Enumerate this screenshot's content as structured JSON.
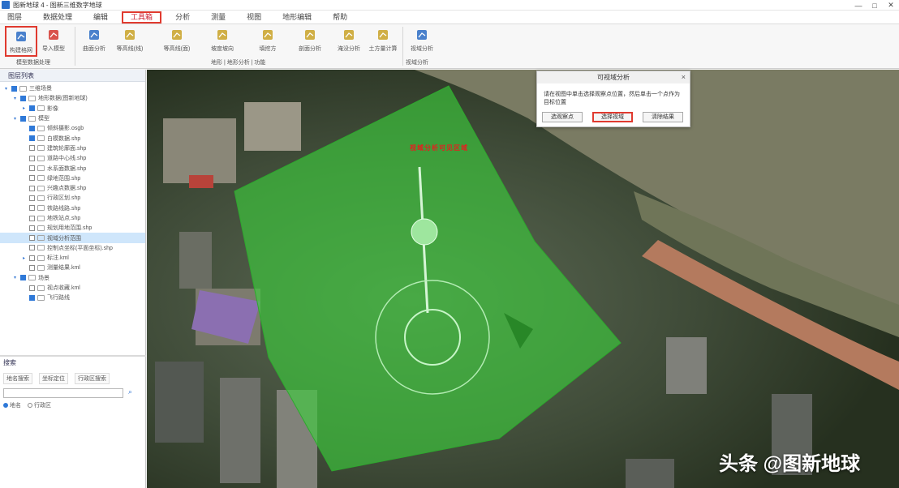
{
  "titlebar": {
    "title": "图新地球 4 - 图新三维数字地球",
    "minimize": "—",
    "maximize": "□",
    "close": "✕"
  },
  "menu": {
    "items": [
      "图层",
      "数据处理",
      "编辑",
      "工具箱",
      "分析",
      "测量",
      "视图",
      "地形编辑",
      "帮助"
    ],
    "active_index": 3
  },
  "ribbon": {
    "buttons": [
      {
        "label": "构建格网",
        "icon": "grid-icon"
      },
      {
        "label": "导入模型",
        "icon": "import-icon"
      },
      {
        "label": "曲面分析",
        "icon": "curve-icon"
      },
      {
        "label": "等高线(线)",
        "icon": "contour-icon"
      },
      {
        "label": "等高线(面)",
        "icon": "contour-area-icon"
      },
      {
        "label": "坡度坡向",
        "icon": "slope-icon"
      },
      {
        "label": "填挖方",
        "icon": "cutfill-icon"
      },
      {
        "label": "剖面分析",
        "icon": "profile-icon"
      },
      {
        "label": "淹没分析",
        "icon": "flood-icon"
      },
      {
        "label": "土方量计算",
        "icon": "volume-icon"
      },
      {
        "label": "视域分析",
        "icon": "viewshed-icon"
      }
    ],
    "groups": [
      "模型数据处理",
      "地形 | 地形分析 | 功能",
      "视域分析"
    ]
  },
  "panel": {
    "header": "图层列表",
    "tree": [
      {
        "label": "三维场景",
        "level": 0,
        "checked": true,
        "arrow": "▾"
      },
      {
        "label": "地形数据(图新地球)",
        "level": 1,
        "checked": true,
        "arrow": "▾"
      },
      {
        "label": "影像",
        "level": 2,
        "checked": true,
        "arrow": "▸"
      },
      {
        "label": "模型",
        "level": 1,
        "checked": true,
        "arrow": "▾"
      },
      {
        "label": "倾斜摄影.osgb",
        "level": 2,
        "checked": true,
        "arrow": ""
      },
      {
        "label": "白模数据.shp",
        "level": 2,
        "checked": true,
        "arrow": ""
      },
      {
        "label": "建筑轮廓面.shp",
        "level": 2,
        "checked": false,
        "arrow": ""
      },
      {
        "label": "道路中心线.shp",
        "level": 2,
        "checked": false,
        "arrow": ""
      },
      {
        "label": "水系面数据.shp",
        "level": 2,
        "checked": false,
        "arrow": ""
      },
      {
        "label": "绿地范围.shp",
        "level": 2,
        "checked": false,
        "arrow": ""
      },
      {
        "label": "兴趣点数据.shp",
        "level": 2,
        "checked": false,
        "arrow": ""
      },
      {
        "label": "行政区划.shp",
        "level": 2,
        "checked": false,
        "arrow": ""
      },
      {
        "label": "铁路线路.shp",
        "level": 2,
        "checked": false,
        "arrow": ""
      },
      {
        "label": "地铁站点.shp",
        "level": 2,
        "checked": false,
        "arrow": ""
      },
      {
        "label": "规划用地范围.shp",
        "level": 2,
        "checked": false,
        "arrow": ""
      },
      {
        "label": "视域分析范围",
        "level": 2,
        "checked": false,
        "arrow": "",
        "selected": true
      },
      {
        "label": "控制点坐标(平面坐标).shp",
        "level": 2,
        "checked": false,
        "arrow": ""
      },
      {
        "label": "标注.kml",
        "level": 2,
        "checked": false,
        "arrow": "▸"
      },
      {
        "label": "测量结果.kml",
        "level": 2,
        "checked": false,
        "arrow": ""
      },
      {
        "label": "场景",
        "level": 1,
        "checked": true,
        "arrow": "▾"
      },
      {
        "label": "视点收藏.kml",
        "level": 2,
        "checked": false,
        "arrow": ""
      },
      {
        "label": "飞行路线",
        "level": 2,
        "checked": true,
        "arrow": ""
      }
    ],
    "search_title": "搜索",
    "search_tabs": [
      "地名搜索",
      "坐标定位",
      "行政区搜索"
    ],
    "search_placeholder": "",
    "search_options": [
      "地名",
      "行政区"
    ]
  },
  "dialog": {
    "title": "可视域分析",
    "close": "×",
    "message": "请在视图中单击选择观察点位置，然后单击一个点作为目标位置",
    "buttons": [
      "选观察点",
      "选择视域",
      "清除结果"
    ],
    "highlight_index": 1
  },
  "map": {
    "label": "视域分析可见区域",
    "watermark": "头条 @图新地球"
  },
  "colors": {
    "highlight_border": "#e03a2f",
    "visible_area": "#3cd13c",
    "selection": "#cfe6fb"
  }
}
